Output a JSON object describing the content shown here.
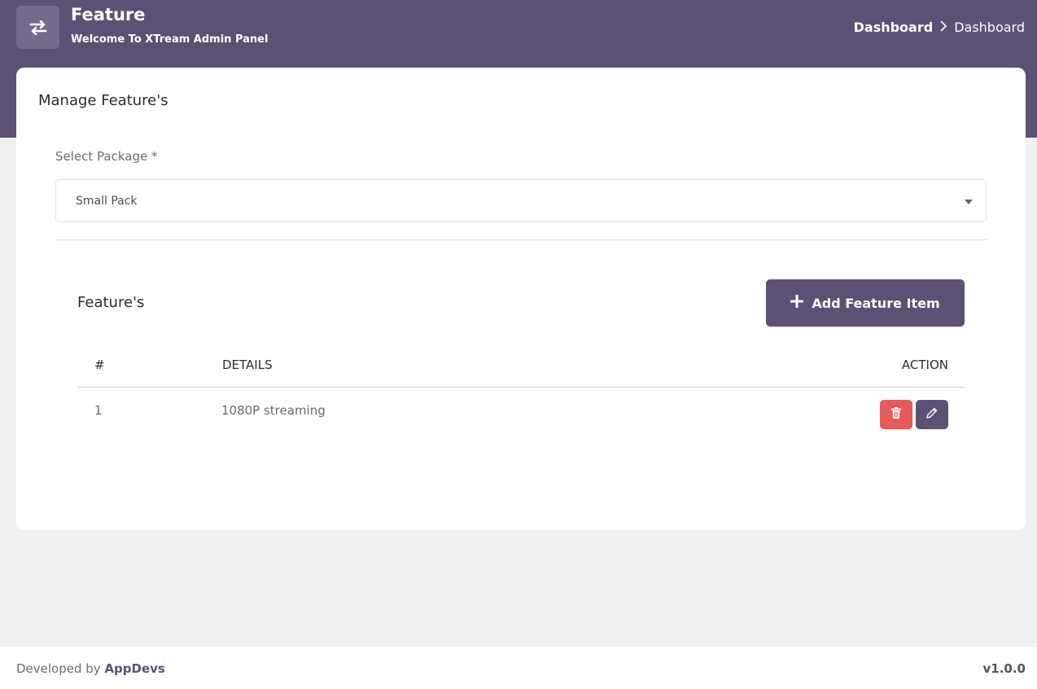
{
  "header": {
    "title": "Feature",
    "subtitle": "Welcome To XTream Admin Panel",
    "icon": "swap-arrows-icon",
    "breadcrumb": [
      "Dashboard",
      "Dashboard"
    ]
  },
  "card": {
    "title": "Manage Feature's",
    "package_label": "Select Package *",
    "package_selected": "Small Pack"
  },
  "features": {
    "title": "Feature's",
    "add_button_label": "Add Feature Item",
    "columns": [
      "#",
      "DETAILS",
      "ACTION"
    ],
    "rows": [
      {
        "num": "1",
        "details": "1080P streaming"
      }
    ]
  },
  "footer": {
    "prefix": "Developed by ",
    "brand": "AppDevs",
    "version": "v1.0.0"
  },
  "colors": {
    "primary": "#5c5174",
    "danger": "#e55a5a",
    "background": "#f1f1f1"
  }
}
